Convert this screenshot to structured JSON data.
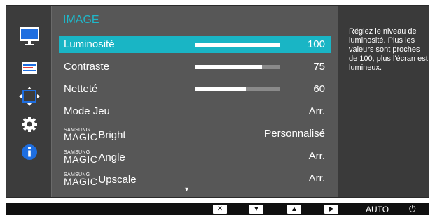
{
  "menu": {
    "title": "IMAGE",
    "brand_small": "SAMSUNG",
    "brand_big": "MAGIC",
    "items": [
      {
        "label": "Luminosité",
        "value": "100",
        "bar": 1.0,
        "selected": true
      },
      {
        "label": "Contraste",
        "value": "75",
        "bar": 0.75
      },
      {
        "label": "Netteté",
        "value": "60",
        "bar": 0.6
      },
      {
        "label": "Mode Jeu",
        "value": "Arr."
      },
      {
        "label": "Bright",
        "value": "Personnalisé",
        "magic": true
      },
      {
        "label": "Angle",
        "value": "Arr.",
        "magic": true
      },
      {
        "label": "Upscale",
        "value": "Arr.",
        "magic": true
      }
    ],
    "more_indicator": "▼"
  },
  "help": {
    "text": "Réglez le niveau de luminosité. Plus les valeurs sont proches de 100, plus l'écran est lumineux."
  },
  "sidebar": {
    "icons": [
      "picture-icon",
      "onscreen-display-icon",
      "resize-icon",
      "settings-gear-icon",
      "info-icon"
    ],
    "active_index": 0
  },
  "keys": {
    "close": "✕",
    "down": "▼",
    "up": "▲",
    "enter": "▶",
    "auto": "AUTO",
    "power": "⏻"
  },
  "colors": {
    "accent": "#19b5c5",
    "title": "#1fb7c9",
    "info": "#1e6ee0"
  }
}
